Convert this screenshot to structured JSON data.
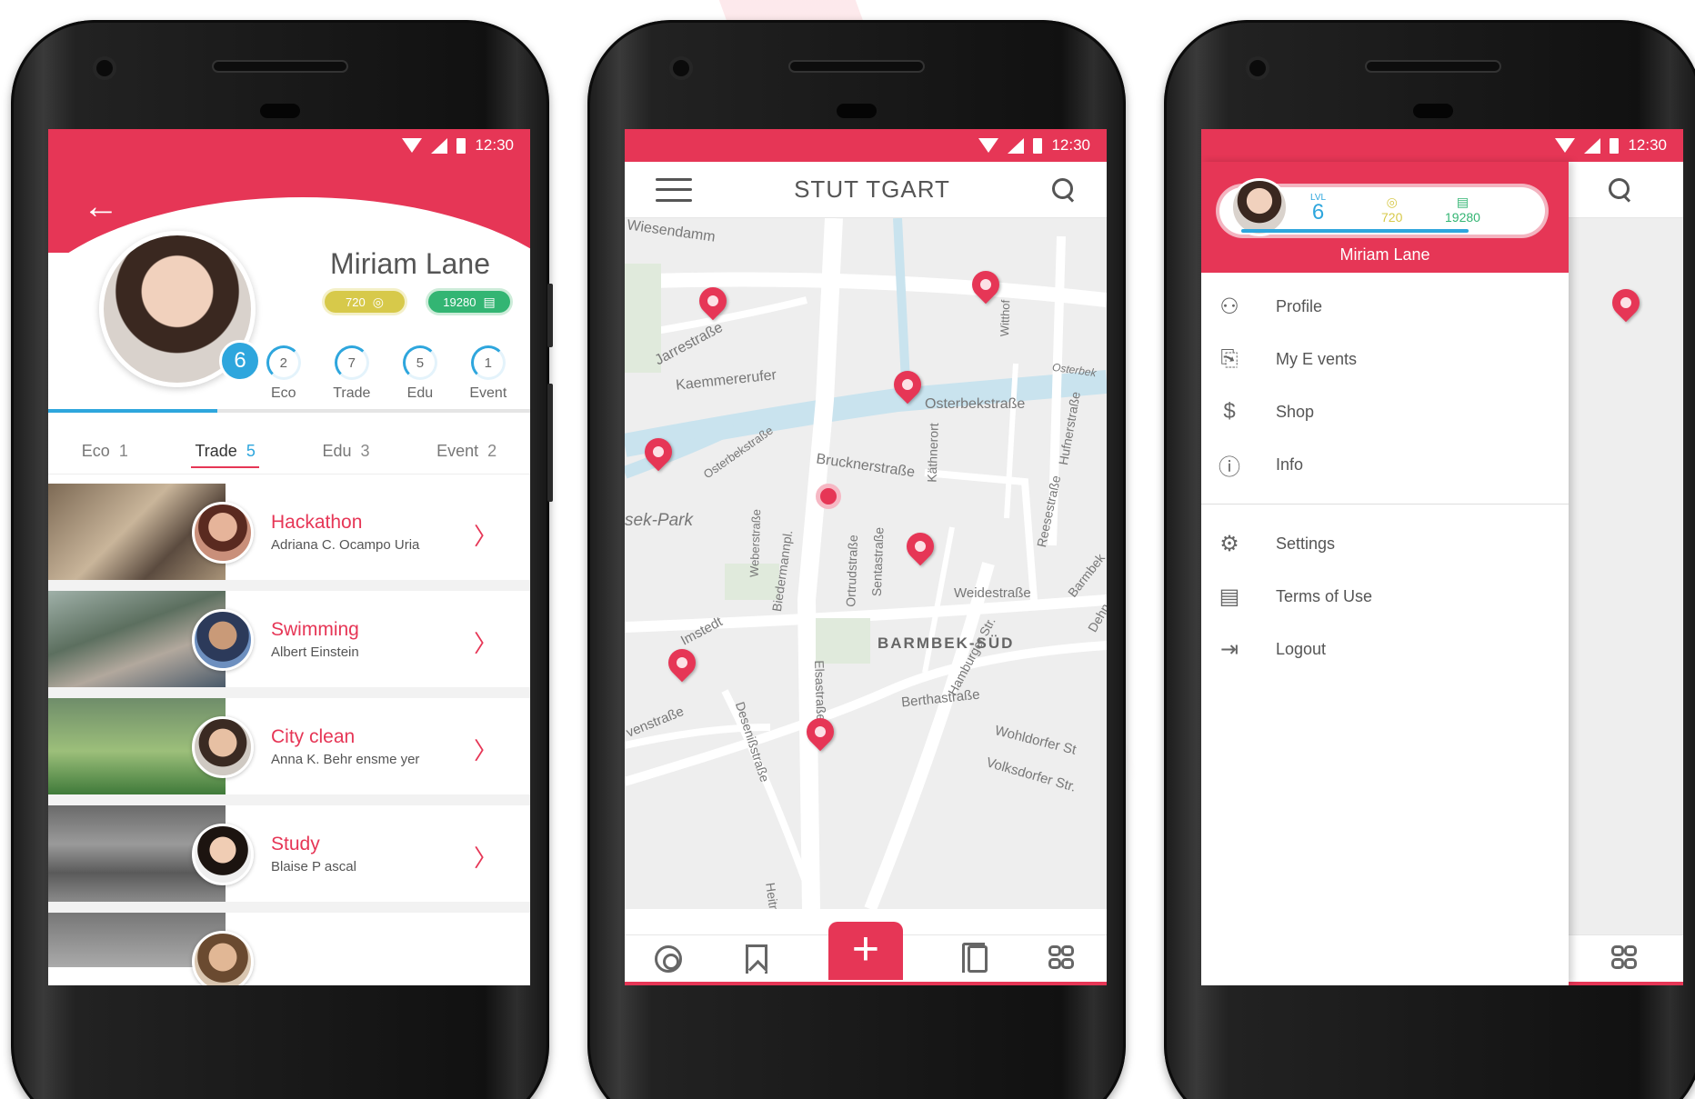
{
  "status": {
    "time": "12:30"
  },
  "profile": {
    "name": "Miriam Lane",
    "level": "6",
    "coins": "720",
    "cash": "19280",
    "level_progress": 0.35,
    "stats": [
      {
        "value": "2",
        "label": "Eco"
      },
      {
        "value": "7",
        "label": "Trade"
      },
      {
        "value": "5",
        "label": "Edu"
      },
      {
        "value": "1",
        "label": "Event"
      }
    ],
    "tabs": [
      {
        "label": "Eco",
        "count": "1"
      },
      {
        "label": "Trade",
        "count": "5",
        "active": true
      },
      {
        "label": "Edu",
        "count": "3"
      },
      {
        "label": "Event",
        "count": "2"
      }
    ],
    "events": [
      {
        "title": "Hackathon",
        "subtitle": "Adriana C. Ocampo Uria"
      },
      {
        "title": "Swimming",
        "subtitle": "Albert Einstein"
      },
      {
        "title": "City clean",
        "subtitle": "Anna K. Behr ensme yer"
      },
      {
        "title": "Study",
        "subtitle": "Blaise P ascal"
      }
    ]
  },
  "map": {
    "title": "STUT TGART",
    "labels": [
      "Wiesendamm",
      "Jarrestraße",
      "Kaemmererufer",
      "Osterbekstraße",
      "Osterbekstraße",
      "Brucknerstraße",
      "Käthnerort",
      "sek-Park",
      "Weberstraße",
      "Biedermannpl.",
      "Ortrudstraße",
      "Sentastraße",
      "Weidestraße",
      "BARMBEK-SÜD",
      "Imstedt",
      "Elsastraße",
      "Berthastraße",
      "Hamburger Str.",
      "Wohldorfer St",
      "Volksdorfer Str.",
      "Desenißstraße",
      "venstraße",
      "Heitm",
      "Reesestraße",
      "Hufnerstraße",
      "Witthof",
      "Barmbek",
      "Osterbek",
      "Dehn"
    ]
  },
  "drawer": {
    "level_label": "LVL",
    "level": "6",
    "coins": "720",
    "cash": "19280",
    "name": "Miriam Lane",
    "menu": [
      {
        "label": "Profile",
        "icon": "user-icon"
      },
      {
        "label": "My E vents",
        "icon": "bookmark-icon"
      },
      {
        "label": "Shop",
        "icon": "dollar-icon"
      },
      {
        "label": "Info",
        "icon": "info-icon"
      }
    ],
    "menu2": [
      {
        "label": "Settings",
        "icon": "gear-icon"
      },
      {
        "label": "Terms of Use",
        "icon": "document-icon"
      },
      {
        "label": "Logout",
        "icon": "logout-icon"
      }
    ]
  },
  "colors": {
    "accent": "#e63656",
    "blue": "#2ea6dd",
    "gold": "#d7c94a",
    "green": "#33b573"
  }
}
